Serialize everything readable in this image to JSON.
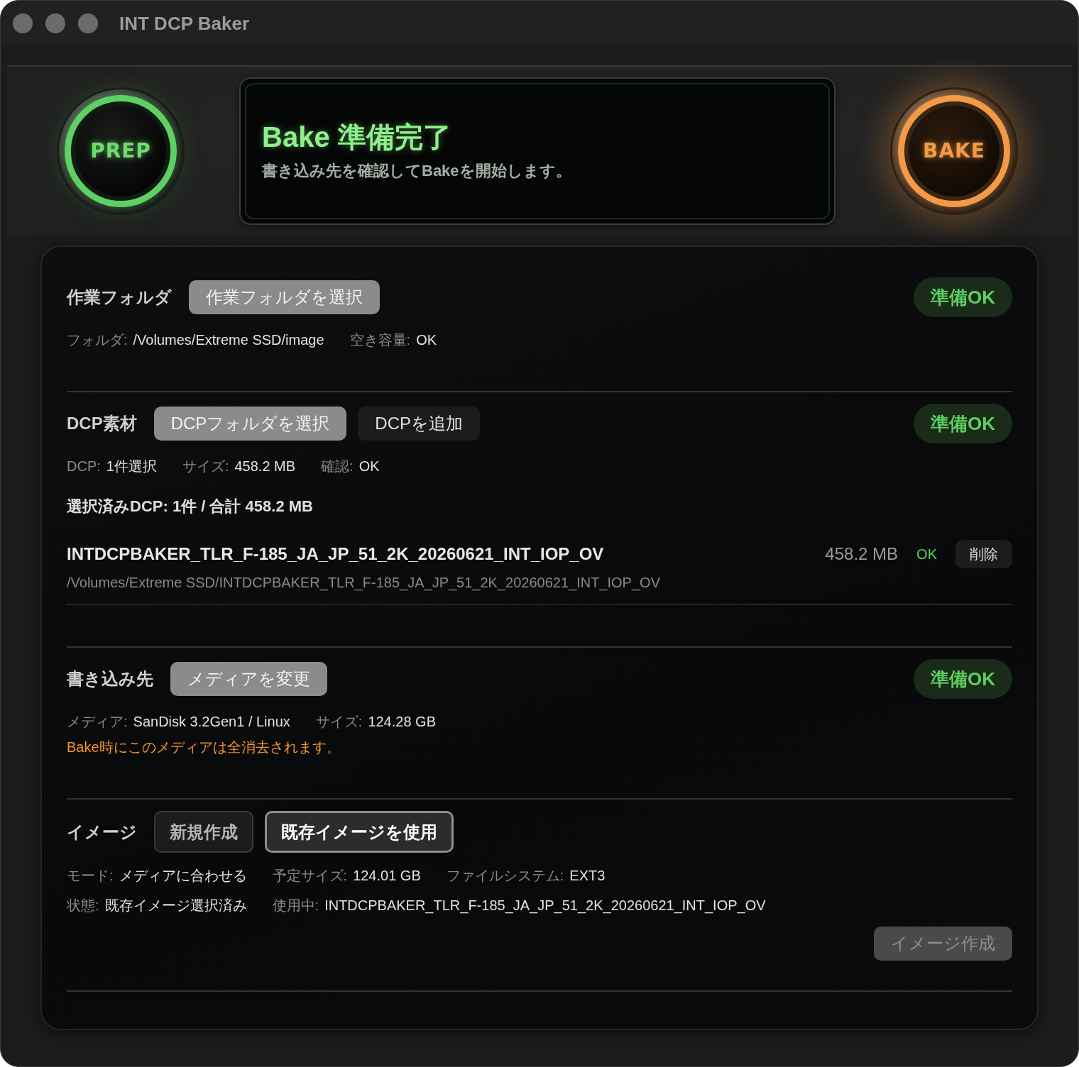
{
  "window": {
    "title": "INT DCP Baker"
  },
  "header": {
    "prep_button": {
      "label": "PREP"
    },
    "status": {
      "title": "Bake 準備完了",
      "message": "書き込み先を確認してBakeを開始します。"
    },
    "bake_button": {
      "label": "BAKE"
    }
  },
  "sections": [
    {
      "label": "作業フォルダ",
      "buttons": [
        {
          "label": "作業フォルダを選択",
          "kind": "primary"
        }
      ],
      "badge": "準備OK",
      "info_rows": [
        [
          {
            "key": "フォルダ:",
            "value": "/Volumes/Extreme SSD/image"
          },
          {
            "key": "空き容量:",
            "value": "OK"
          }
        ]
      ]
    },
    {
      "label": "DCP素材",
      "buttons": [
        {
          "label": "DCPフォルダを選択",
          "kind": "primary"
        },
        {
          "label": "DCPを追加",
          "kind": "secondary"
        }
      ],
      "badge": "準備OK",
      "info_rows": [
        [
          {
            "key": "DCP:",
            "value": "1件選択"
          },
          {
            "key": "サイズ:",
            "value": "458.2 MB"
          },
          {
            "key": "確認:",
            "value": "OK"
          }
        ]
      ],
      "summary": "選択済みDCP: 1件 / 合計 458.2 MB",
      "items": [
        {
          "name": "INTDCPBAKER_TLR_F-185_JA_JP_51_2K_20260621_INT_IOP_OV",
          "path": "/Volumes/Extreme SSD/INTDCPBAKER_TLR_F-185_JA_JP_51_2K_20260621_INT_IOP_OV",
          "size": "458.2 MB",
          "status": "OK",
          "remove_label": "削除"
        }
      ]
    },
    {
      "label": "書き込み先",
      "buttons": [
        {
          "label": "メディアを変更",
          "kind": "primary"
        }
      ],
      "badge": "準備OK",
      "info_rows": [
        [
          {
            "key": "メディア:",
            "value": "SanDisk 3.2Gen1 / Linux"
          },
          {
            "key": "サイズ:",
            "value": "124.28 GB"
          }
        ]
      ],
      "warning": "Bake時にこのメディアは全消去されます。"
    },
    {
      "label": "イメージ",
      "modes": [
        {
          "label": "新規作成",
          "selected": false
        },
        {
          "label": "既存イメージを使用",
          "selected": true
        }
      ],
      "info_rows": [
        [
          {
            "key": "モード:",
            "value": "メディアに合わせる"
          },
          {
            "key": "予定サイズ:",
            "value": "124.01 GB"
          },
          {
            "key": "ファイルシステム:",
            "value": "EXT3"
          }
        ],
        [
          {
            "key": "状態:",
            "value": "既存イメージ選択済み"
          },
          {
            "key": "使用中:",
            "value": "INTDCPBAKER_TLR_F-185_JA_JP_51_2K_20260621_INT_IOP_OV"
          }
        ]
      ],
      "action": {
        "label": "イメージ作成",
        "disabled": true
      }
    }
  ]
}
